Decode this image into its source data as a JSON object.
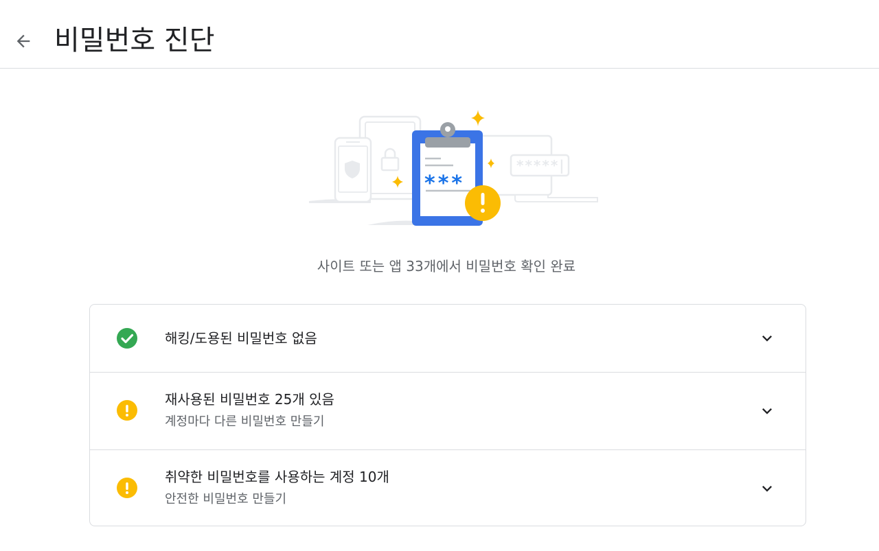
{
  "header": {
    "title": "비밀번호 진단",
    "back_icon": "arrow-back-icon"
  },
  "summary": {
    "text": "사이트 또는 앱 33개에서 비밀번호 확인 완료"
  },
  "illustration": {
    "masked_password": "*****|",
    "clipboard_stars": "***"
  },
  "checks": [
    {
      "status": "ok",
      "icon": "check-circle-icon",
      "color": "#34a853",
      "title": "해킹/도용된 비밀번호 없음",
      "subtitle": ""
    },
    {
      "status": "warning",
      "icon": "warning-circle-icon",
      "color": "#fbbc04",
      "title": "재사용된 비밀번호 25개 있음",
      "subtitle": "계정마다 다른 비밀번호 만들기"
    },
    {
      "status": "warning",
      "icon": "warning-circle-icon",
      "color": "#fbbc04",
      "title": "취약한 비밀번호를 사용하는 계정 10개",
      "subtitle": "안전한 비밀번호 만들기"
    }
  ],
  "colors": {
    "accent_blue": "#3b74e6",
    "success_green": "#34a853",
    "warning_yellow": "#fbbc04",
    "divider": "#dadce0"
  }
}
